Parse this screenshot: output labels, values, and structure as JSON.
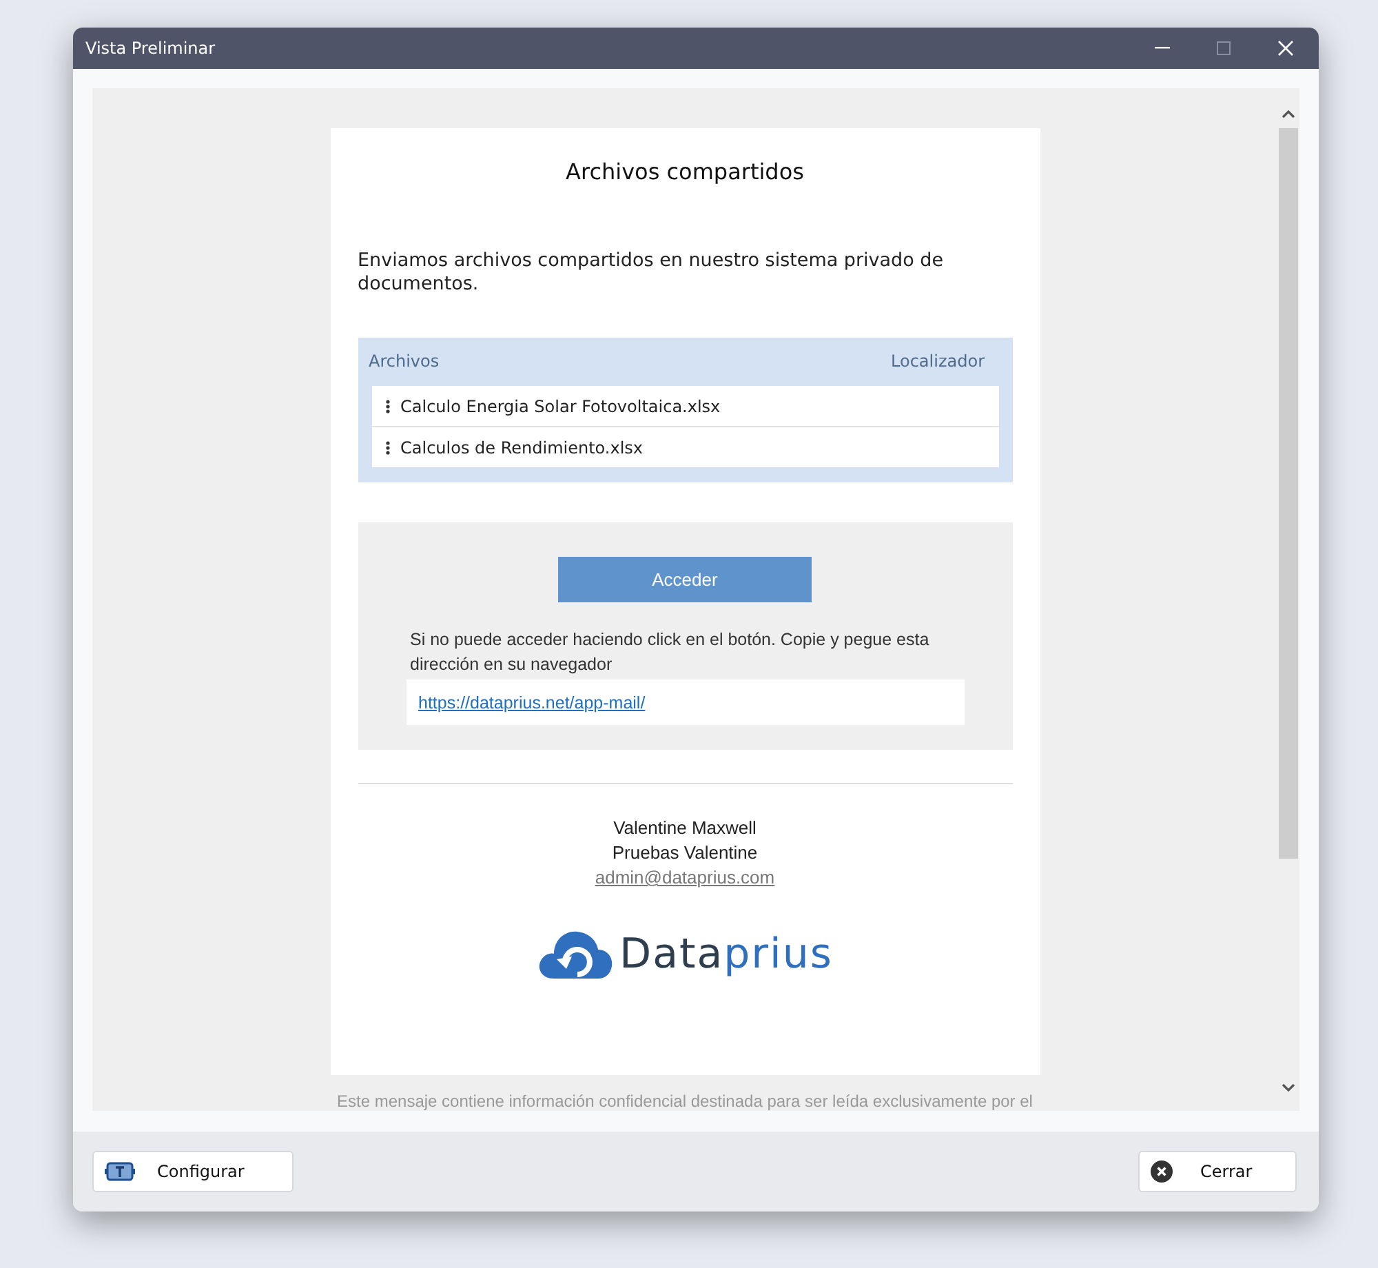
{
  "window": {
    "title": "Vista Preliminar"
  },
  "email": {
    "title": "Archivos compartidos",
    "intro": "Enviamos archivos compartidos en nuestro sistema privado de documentos.",
    "files": {
      "columns": [
        "Archivos",
        "Localizador"
      ],
      "rows": [
        {
          "name": "Calculo Energia Solar Fotovoltaica.xlsx"
        },
        {
          "name": "Calculos de Rendimiento.xlsx"
        }
      ]
    },
    "access_button": "Acceder",
    "access_note": "Si no puede acceder haciendo click en el botón. Copie y pegue esta dirección en su navegador",
    "access_link": "https://dataprius.net/app-mail/",
    "signature": {
      "name": "Valentine Maxwell",
      "company": "Pruebas Valentine",
      "email": "admin@dataprius.com"
    },
    "logo": [
      {
        "text": "Data",
        "kind": "dark"
      },
      {
        "text": "prius",
        "kind": "accent"
      }
    ],
    "disclaimer": "Este mensaje contiene información confidencial destinada para ser leída exclusivamente por el"
  },
  "buttons": [
    {
      "label": "Configurar",
      "kind": "configure"
    },
    {
      "label": "Cerrar",
      "kind": "close"
    }
  ]
}
